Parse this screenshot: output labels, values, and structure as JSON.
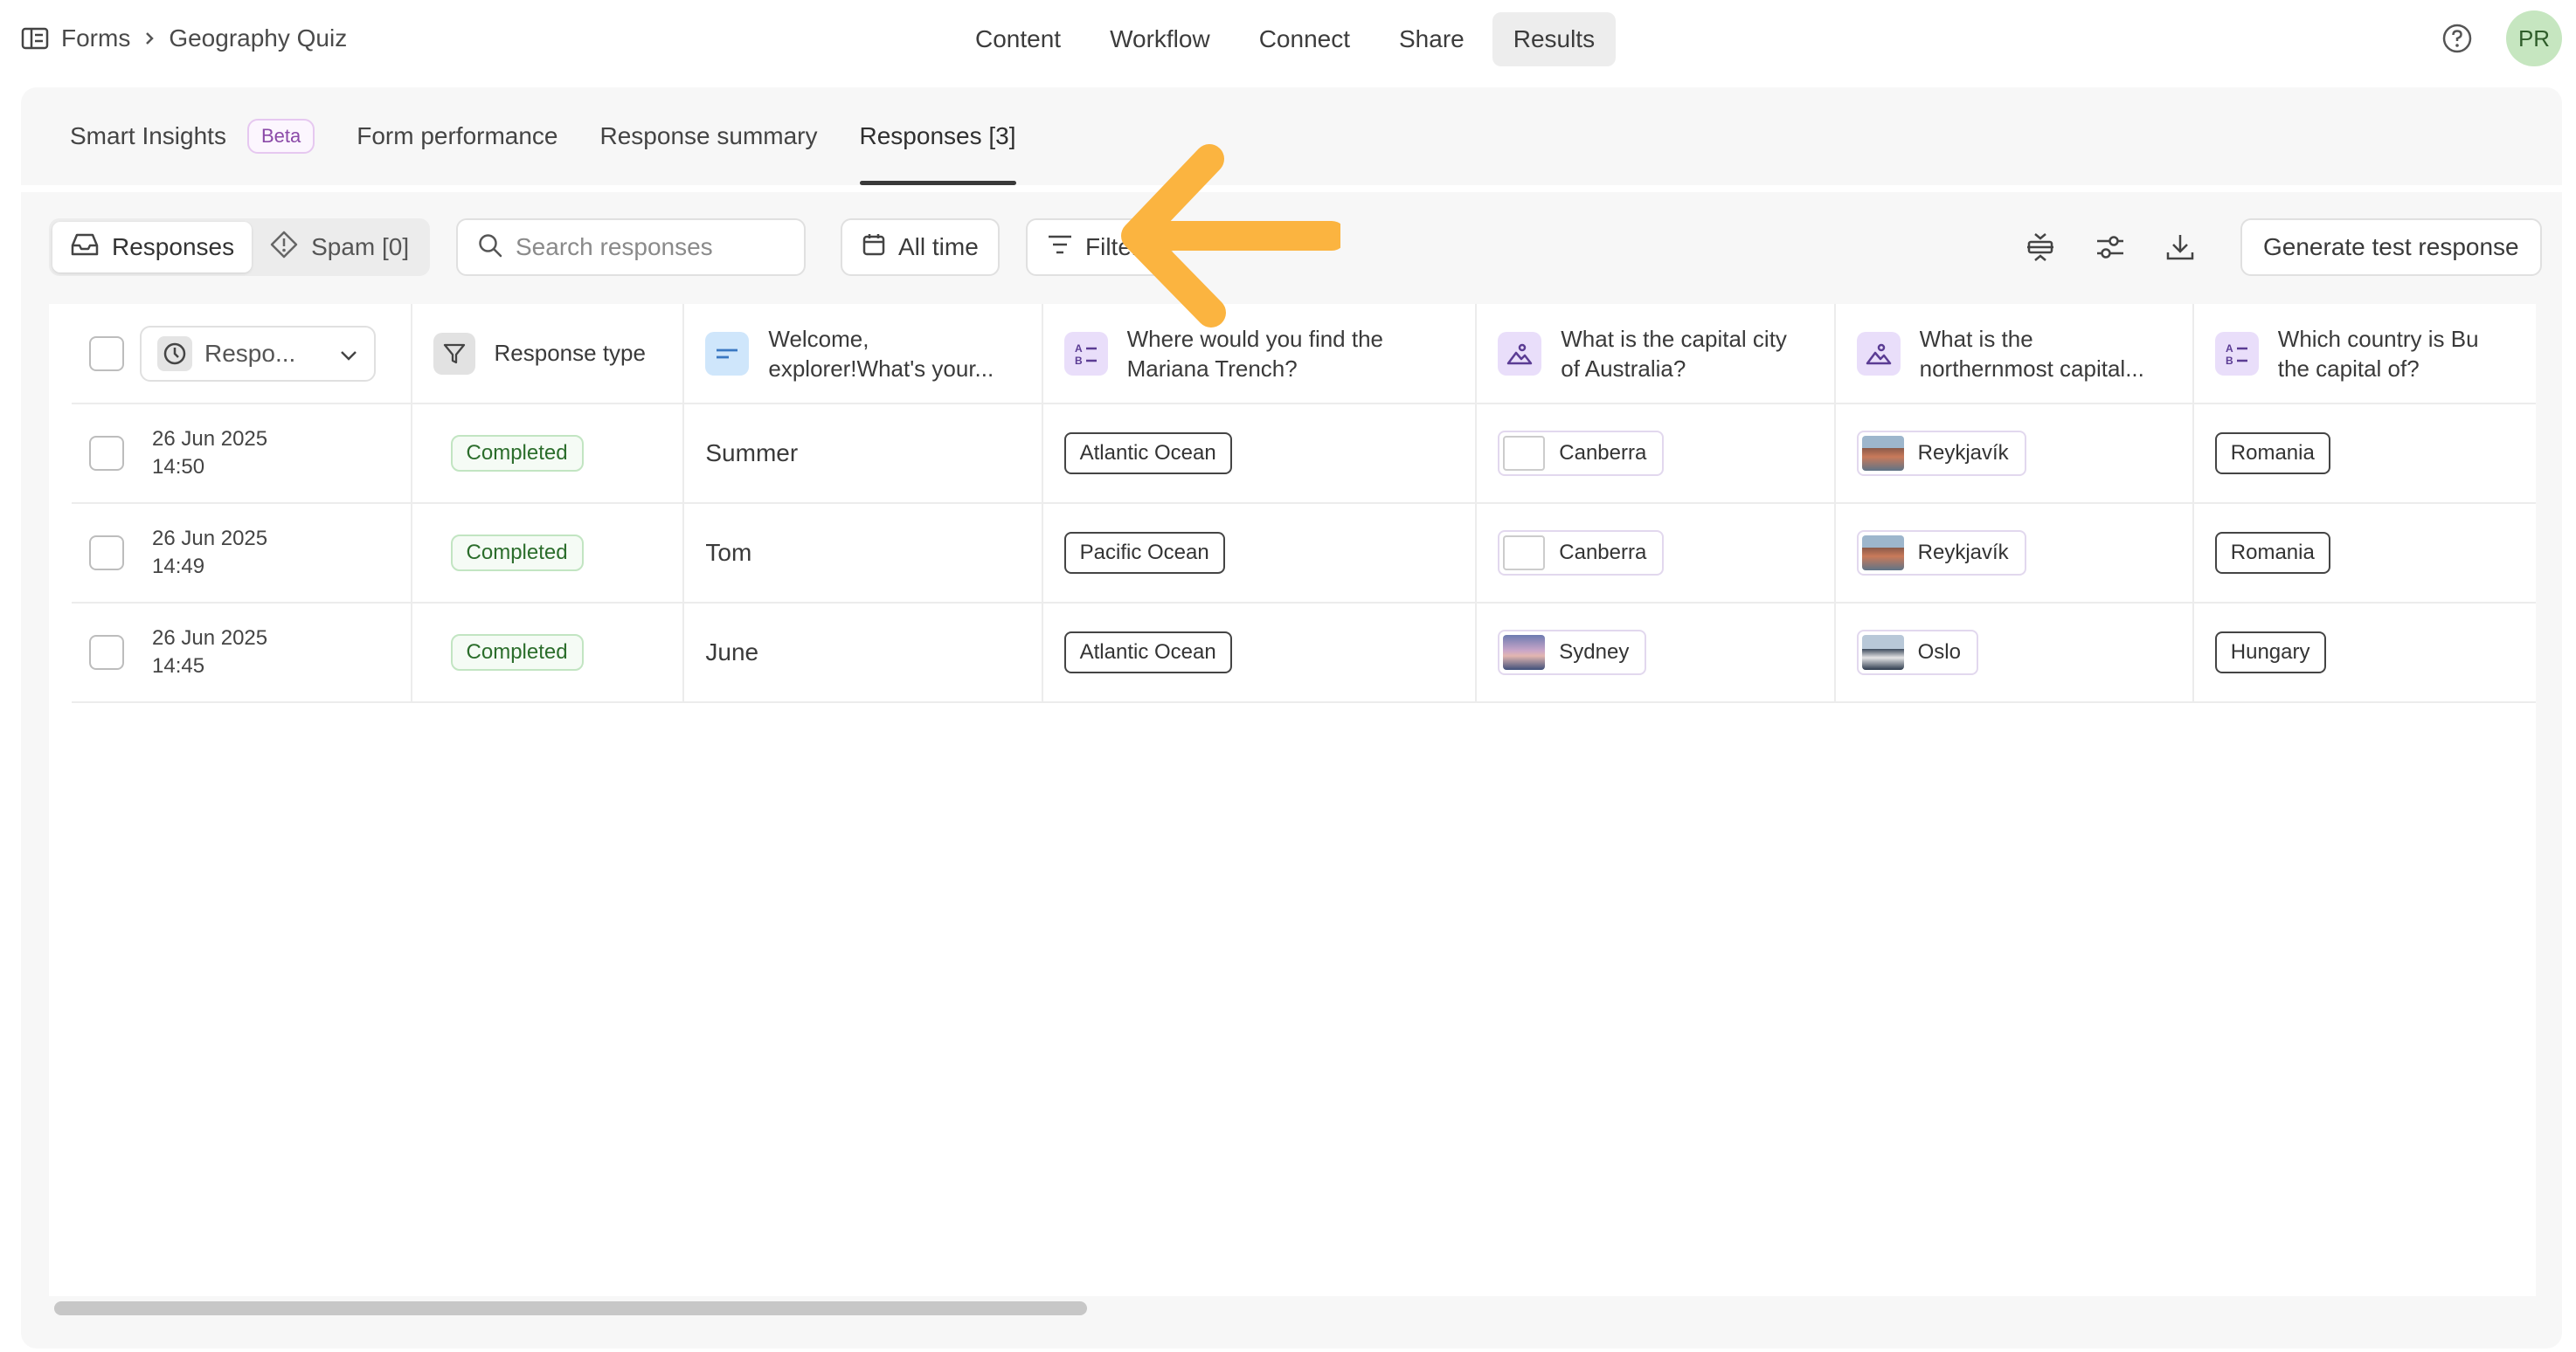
{
  "breadcrumb": {
    "root": "Forms",
    "current": "Geography Quiz"
  },
  "nav": [
    "Content",
    "Workflow",
    "Connect",
    "Share",
    "Results"
  ],
  "nav_active": "Results",
  "user": {
    "initials": "PR"
  },
  "subtabs": {
    "smart_insights": "Smart Insights",
    "beta": "Beta",
    "form_performance": "Form performance",
    "response_summary": "Response summary",
    "responses": "Responses [3]"
  },
  "toolbar": {
    "responses": "Responses",
    "spam": "Spam [0]",
    "search_placeholder": "Search responses",
    "all_time": "All time",
    "filters": "Filters",
    "generate": "Generate test response"
  },
  "table": {
    "sort_label": "Respo...",
    "columns": {
      "type": "Response type",
      "q1": [
        "Welcome,",
        "explorer!What's your..."
      ],
      "q2": [
        "Where would you find the",
        "Mariana Trench?"
      ],
      "q3": [
        "What is the capital city",
        "of Australia?"
      ],
      "q4": [
        "What is the",
        "northernmost capital..."
      ],
      "q5": [
        "Which country is Bu",
        "the capital of?"
      ]
    },
    "rows": [
      {
        "date": "26 Jun 2025",
        "time": "14:50",
        "status": "Completed",
        "name": "Summer",
        "ocean": "Atlantic Ocean",
        "capital_au": "Canberra",
        "northern": "Reykjavík",
        "country": "Romania"
      },
      {
        "date": "26 Jun 2025",
        "time": "14:49",
        "status": "Completed",
        "name": "Tom",
        "ocean": "Pacific Ocean",
        "capital_au": "Canberra",
        "northern": "Reykjavík",
        "country": "Romania"
      },
      {
        "date": "26 Jun 2025",
        "time": "14:45",
        "status": "Completed",
        "name": "June",
        "ocean": "Atlantic Ocean",
        "capital_au": "Sydney",
        "northern": "Oslo",
        "country": "Hungary"
      }
    ]
  },
  "colors": {
    "accent_arrow": "#fbb440",
    "status_green": "#2b6d2b",
    "avatar_bg": "#c6e6c0"
  }
}
